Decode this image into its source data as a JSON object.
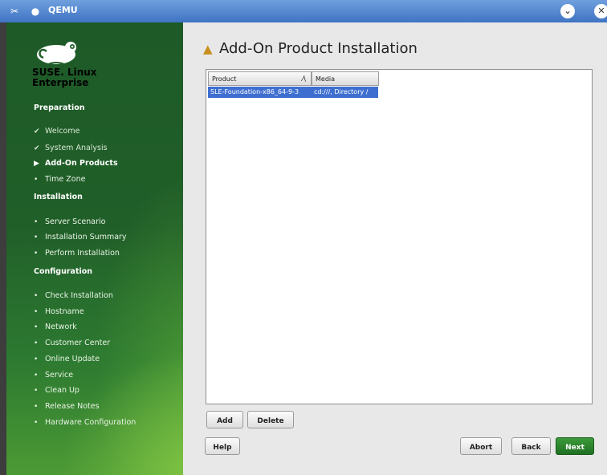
{
  "window": {
    "title": "QEMU"
  },
  "sidebar": {
    "brand_line1": "SUSE. Linux",
    "brand_line2": "Enterprise",
    "sections": [
      {
        "title": "Preparation",
        "steps": [
          {
            "label": "Welcome",
            "state": "done"
          },
          {
            "label": "System Analysis",
            "state": "done"
          },
          {
            "label": "Add-On Products",
            "state": "current"
          },
          {
            "label": "Time Zone",
            "state": "pending"
          }
        ]
      },
      {
        "title": "Installation",
        "steps": [
          {
            "label": "Server Scenario",
            "state": "pending"
          },
          {
            "label": "Installation Summary",
            "state": "pending"
          },
          {
            "label": "Perform Installation",
            "state": "pending"
          }
        ]
      },
      {
        "title": "Configuration",
        "steps": [
          {
            "label": "Check Installation",
            "state": "pending"
          },
          {
            "label": "Hostname",
            "state": "pending"
          },
          {
            "label": "Network",
            "state": "pending"
          },
          {
            "label": "Customer Center",
            "state": "pending"
          },
          {
            "label": "Online Update",
            "state": "pending"
          },
          {
            "label": "Service",
            "state": "pending"
          },
          {
            "label": "Clean Up",
            "state": "pending"
          },
          {
            "label": "Release Notes",
            "state": "pending"
          },
          {
            "label": "Hardware Configuration",
            "state": "pending"
          }
        ]
      }
    ],
    "icons": {
      "done": "checkmark-icon",
      "current": "arrow-right-icon",
      "pending": "bullet-icon"
    }
  },
  "page": {
    "title": "Add-On Product Installation",
    "icon": "package-icon",
    "table": {
      "columns": [
        "Product",
        "Media"
      ],
      "rows": [
        [
          "SLE-Foundation-x86_64-9-3",
          "cd:///, Directory /"
        ]
      ]
    },
    "buttons": {
      "add": "Add",
      "delete": "Delete",
      "help": "Help",
      "abort": "Abort",
      "back": "Back",
      "next": "Next"
    }
  },
  "colors": {
    "accent": "#3e6fd0",
    "sidebar": "#215f29",
    "next_button": "#2a8030"
  }
}
